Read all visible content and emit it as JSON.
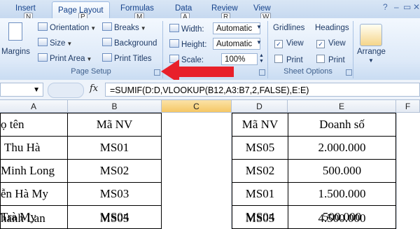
{
  "tabs": [
    {
      "label": "Insert",
      "keytip": "N",
      "active": false
    },
    {
      "label": "Page Layout",
      "keytip": "P",
      "active": true
    },
    {
      "label": "Formulas",
      "keytip": "M",
      "active": false
    },
    {
      "label": "Data",
      "keytip": "A",
      "active": false
    },
    {
      "label": "Review",
      "keytip": "R",
      "active": false
    },
    {
      "label": "View",
      "keytip": "W",
      "active": false
    }
  ],
  "ribbon": {
    "margins": "Margins",
    "orientation": "Orientation",
    "size": "Size",
    "print_area": "Print Area",
    "breaks": "Breaks",
    "background": "Background",
    "print_titles": "Print Titles",
    "page_setup": "Page Setup",
    "width_label": "Width:",
    "width_value": "Automatic",
    "height_label": "Height:",
    "height_value": "Automatic",
    "scale_label": "Scale:",
    "scale_value": "100%",
    "gridlines": "Gridlines",
    "headings": "Headings",
    "view": "View",
    "print": "Print",
    "sheet_options": "Sheet Options",
    "arrange": "Arrange"
  },
  "formula_bar": {
    "fx": "fx",
    "formula": "=SUMIF(D:D,VLOOKUP(B12,A3:B7,2,FALSE),E:E)"
  },
  "columns": [
    "A",
    "B",
    "C",
    "D",
    "E",
    "F"
  ],
  "left_table": {
    "header": [
      "ọ tên",
      "Mã NV"
    ],
    "rows": [
      [
        "Thu Hà",
        "MS01"
      ],
      [
        "Minh Long",
        "MS02"
      ],
      [
        "ễn Hà My",
        "MS03"
      ],
      [
        "Trà My",
        "MS04"
      ],
      [
        "hanh Lan",
        "MS05"
      ]
    ]
  },
  "right_table": {
    "header": [
      "Mã NV",
      "Doanh số"
    ],
    "rows": [
      [
        "MS05",
        "2.000.000"
      ],
      [
        "MS02",
        "500.000"
      ],
      [
        "MS01",
        "1.500.000"
      ],
      [
        "MS04",
        "500.000"
      ],
      [
        "MS05",
        "4.500.000"
      ]
    ]
  },
  "colors": {
    "arrow": "#e8202a",
    "accent": "#15428b"
  }
}
